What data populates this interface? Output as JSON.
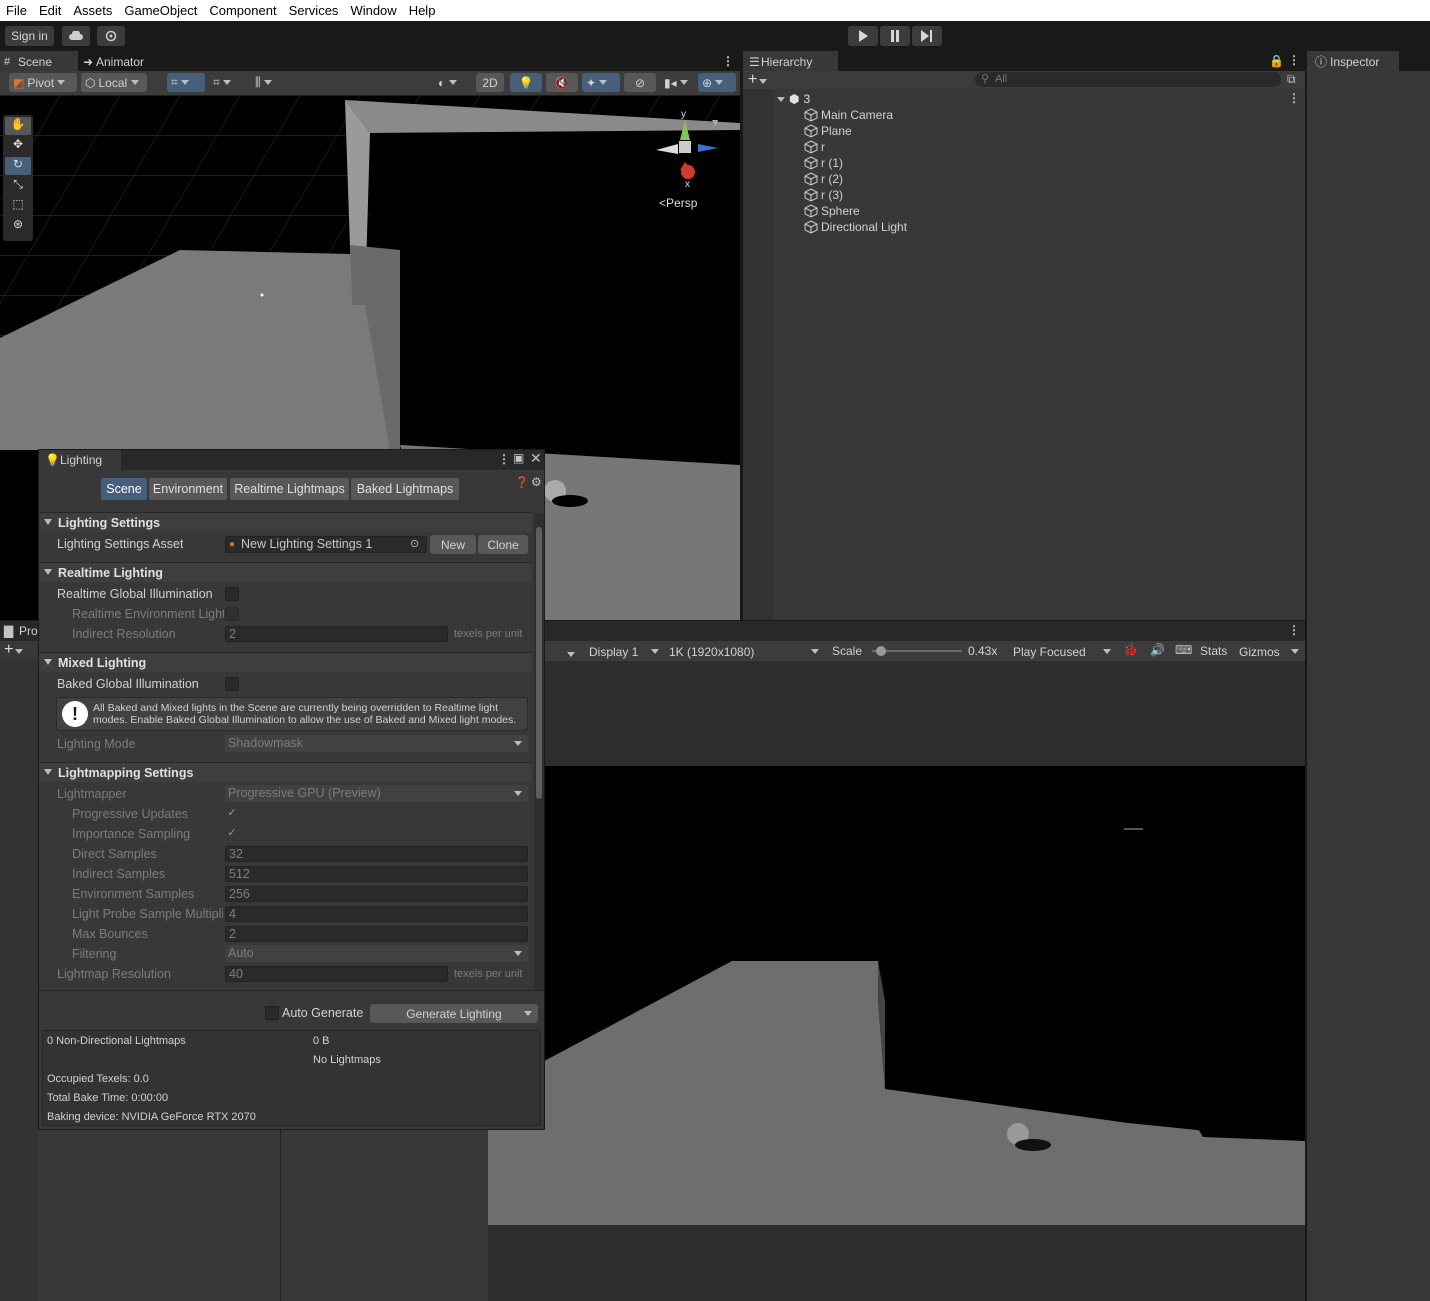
{
  "menu": [
    "File",
    "Edit",
    "Assets",
    "GameObject",
    "Component",
    "Services",
    "Window",
    "Help"
  ],
  "toolbar": {
    "sign_in": "Sign in"
  },
  "scene_tabs": {
    "scene": "Scene",
    "animator": "Animator"
  },
  "scene_toolbar": {
    "pivot": "Pivot",
    "local": "Local",
    "two_d": "2D"
  },
  "gizmo": {
    "y": "y",
    "x": "x",
    "persp": "Persp"
  },
  "hierarchy": {
    "tab": "Hierarchy",
    "search_placeholder": "All",
    "scene_name": "3",
    "items": [
      "Main Camera",
      "Plane",
      "r",
      "r (1)",
      "r (2)",
      "r (3)",
      "Sphere",
      "Directional Light"
    ]
  },
  "inspector": {
    "tab": "Inspector"
  },
  "project": {
    "tab": "Pro"
  },
  "game_toolbar": {
    "display": "Display 1",
    "resolution": "1K (1920x1080)",
    "scale_label": "Scale",
    "scale_value": "0.43x",
    "scale_fraction": 0.05,
    "play_mode": "Play Focused",
    "stats": "Stats",
    "gizmos": "Gizmos"
  },
  "lighting": {
    "title": "Lighting",
    "tabs": [
      "Scene",
      "Environment",
      "Realtime Lightmaps",
      "Baked Lightmaps"
    ],
    "sections": {
      "lighting_settings": "Lighting Settings",
      "realtime_lighting": "Realtime Lighting",
      "mixed_lighting": "Mixed Lighting",
      "lightmapping_settings": "Lightmapping Settings"
    },
    "settings_asset_label": "Lighting Settings Asset",
    "settings_asset_value": "New Lighting Settings 1",
    "new_button": "New",
    "clone_button": "Clone",
    "realtime_gi": "Realtime Global Illumination",
    "realtime_env_light": "Realtime Environment Light",
    "indirect_resolution": "Indirect Resolution",
    "indirect_resolution_value": "2",
    "texels_per_unit": "texels per unit",
    "baked_gi": "Baked Global Illumination",
    "warning": "All Baked and Mixed lights in the Scene are currently being overridden to Realtime light modes. Enable Baked Global Illumination to allow the use of Baked and Mixed light modes.",
    "lighting_mode": "Lighting Mode",
    "lighting_mode_value": "Shadowmask",
    "lightmapper": "Lightmapper",
    "lightmapper_value": "Progressive GPU (Preview)",
    "progressive_updates": "Progressive Updates",
    "importance_sampling": "Importance Sampling",
    "check_mark": "✓",
    "direct_samples": "Direct Samples",
    "direct_samples_value": "32",
    "indirect_samples": "Indirect Samples",
    "indirect_samples_value": "512",
    "environment_samples": "Environment Samples",
    "environment_samples_value": "256",
    "light_probe_mult": "Light Probe Sample Multiplier",
    "light_probe_mult_value": "4",
    "max_bounces": "Max Bounces",
    "max_bounces_value": "2",
    "filtering": "Filtering",
    "filtering_value": "Auto",
    "lightmap_resolution": "Lightmap Resolution",
    "lightmap_resolution_value": "40",
    "auto_generate": "Auto Generate",
    "generate_lighting": "Generate Lighting",
    "stats": {
      "non_directional": "0 Non-Directional Lightmaps",
      "size": "0 B",
      "no_lightmaps": "No Lightmaps",
      "occupied_texels": "Occupied Texels: 0.0",
      "bake_time": "Total Bake Time: 0:00:00",
      "baking_device": "Baking device: NVIDIA GeForce RTX 2070"
    }
  }
}
